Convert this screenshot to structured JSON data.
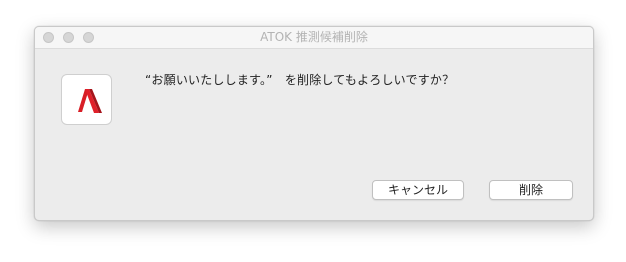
{
  "window": {
    "title": "ATOK 推測候補削除"
  },
  "dialog": {
    "message": "“お願いいたしします。”　を削除してもよろしいですか？",
    "app_icon": "atok-icon",
    "brand_color": "#e0202a"
  },
  "buttons": {
    "cancel_label": "キャンセル",
    "delete_label": "削除"
  }
}
